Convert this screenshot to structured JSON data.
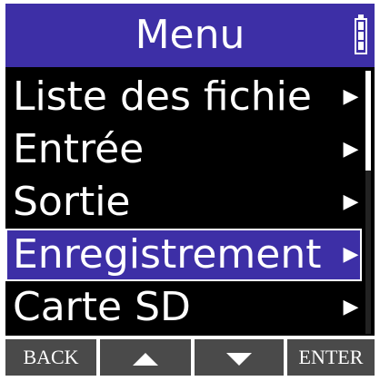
{
  "header": {
    "title": "Menu",
    "battery_icon": "battery-full-icon"
  },
  "menu": {
    "items": [
      {
        "label": "Liste des fichie",
        "icon": "chevron-right-icon",
        "selected": false
      },
      {
        "label": "Entrée",
        "icon": "chevron-right-icon",
        "selected": false
      },
      {
        "label": "Sortie",
        "icon": "chevron-right-icon",
        "selected": false
      },
      {
        "label": "Enregistrement",
        "icon": "chevron-right-icon",
        "selected": true
      },
      {
        "label": "Carte SD",
        "icon": "chevron-right-icon",
        "selected": false
      }
    ]
  },
  "softkeys": {
    "back": "BACK",
    "up_icon": "triangle-up-icon",
    "down_icon": "triangle-down-icon",
    "enter": "ENTER"
  },
  "colors": {
    "accent": "#3d2fa6",
    "background": "#000000",
    "softkey": "#4a4a4a"
  }
}
